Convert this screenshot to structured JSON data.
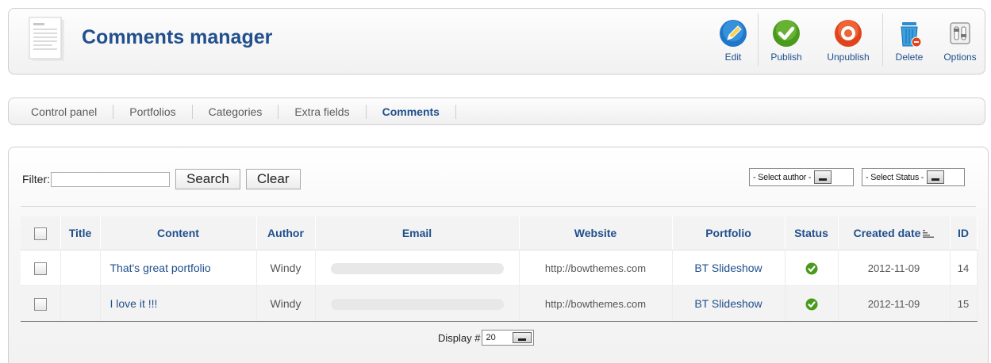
{
  "header": {
    "title": "Comments manager",
    "toolbar": [
      {
        "label": "Edit",
        "icon": "edit-icon"
      },
      {
        "label": "Publish",
        "icon": "publish-icon"
      },
      {
        "label": "Unpublish",
        "icon": "unpublish-icon"
      },
      {
        "label": "Delete",
        "icon": "delete-icon"
      },
      {
        "label": "Options",
        "icon": "options-icon"
      }
    ]
  },
  "submenu": {
    "items": [
      "Control panel",
      "Portfolios",
      "Categories",
      "Extra fields",
      "Comments"
    ],
    "active": "Comments"
  },
  "filter": {
    "label": "Filter:",
    "value": "",
    "search_label": "Search",
    "clear_label": "Clear",
    "author_select": "- Select author -",
    "status_select": "- Select Status -"
  },
  "table": {
    "columns": [
      "Title",
      "Content",
      "Author",
      "Email",
      "Website",
      "Portfolio",
      "Status",
      "Created date",
      "ID"
    ],
    "rows": [
      {
        "title": "",
        "content": "That's great portfolio",
        "author": "Windy",
        "website": "http://bowthemes.com",
        "portfolio": "BT Slideshow",
        "status": "published",
        "date": "2012-11-09",
        "id": "14"
      },
      {
        "title": "",
        "content": "I love it !!!",
        "author": "Windy",
        "website": "http://bowthemes.com",
        "portfolio": "BT Slideshow",
        "status": "published",
        "date": "2012-11-09",
        "id": "15"
      }
    ]
  },
  "footer": {
    "display_label": "Display #",
    "display_value": "20"
  },
  "colors": {
    "title_blue": "#22508f",
    "link_blue": "#1f4f8c",
    "publish_green": "#4a9a1c",
    "unpublish_red": "#e0441b",
    "edit_blue": "#1f77c9"
  }
}
